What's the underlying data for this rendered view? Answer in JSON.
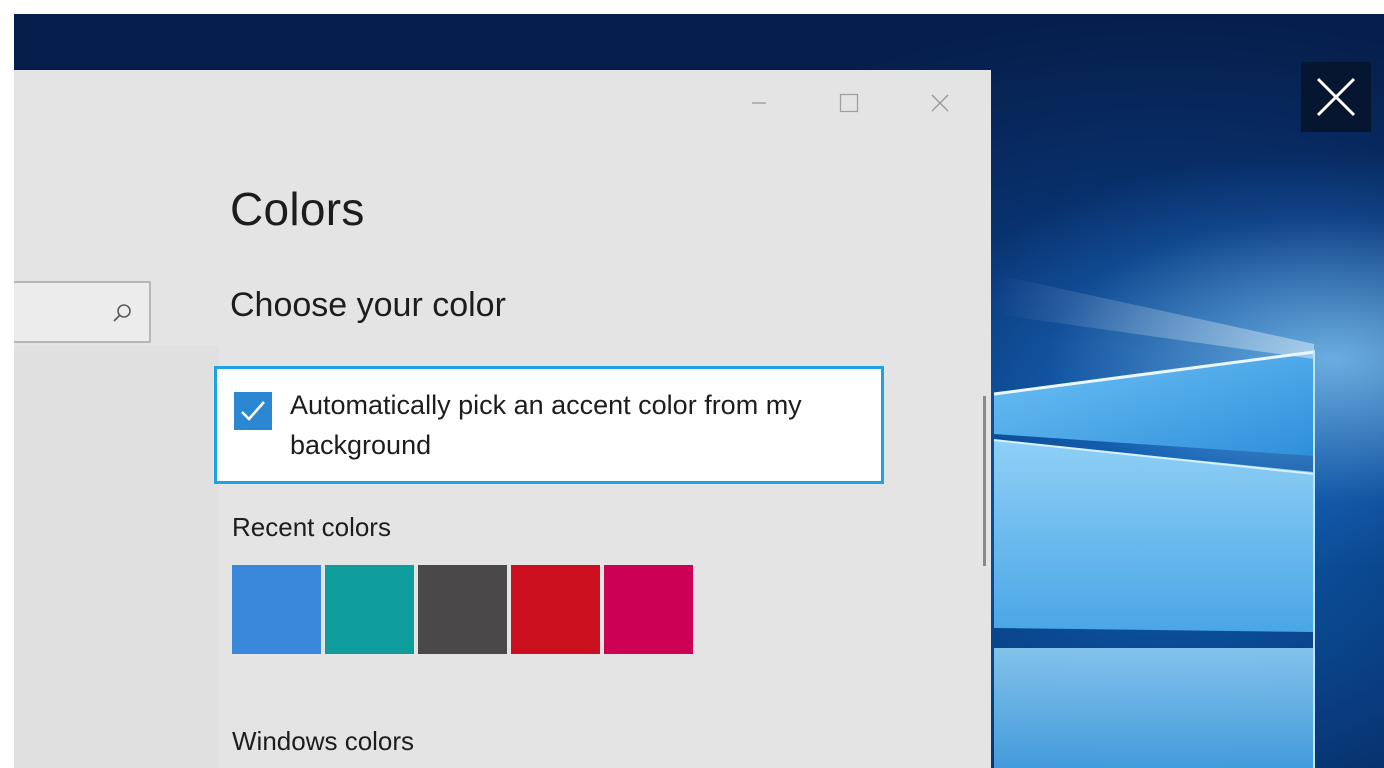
{
  "window": {
    "minimize_label": "Minimize",
    "maximize_label": "Maximize",
    "close_label": "Close"
  },
  "search": {
    "icon": "search-icon",
    "placeholder": ""
  },
  "page": {
    "title": "Colors",
    "section_title": "Choose your color"
  },
  "accent_auto": {
    "checked": true,
    "label": "Automatically pick an accent color from my background"
  },
  "recent_colors": {
    "label": "Recent colors",
    "swatches": [
      "#3a88dc",
      "#0e9c9c",
      "#4a4848",
      "#cc1020",
      "#cc0055"
    ]
  },
  "windows_colors": {
    "label": "Windows colors"
  },
  "colors": {
    "accent_border": "#1ca3e4",
    "checkbox_fill": "#2b87d1",
    "window_background": "#e4e4e4"
  }
}
